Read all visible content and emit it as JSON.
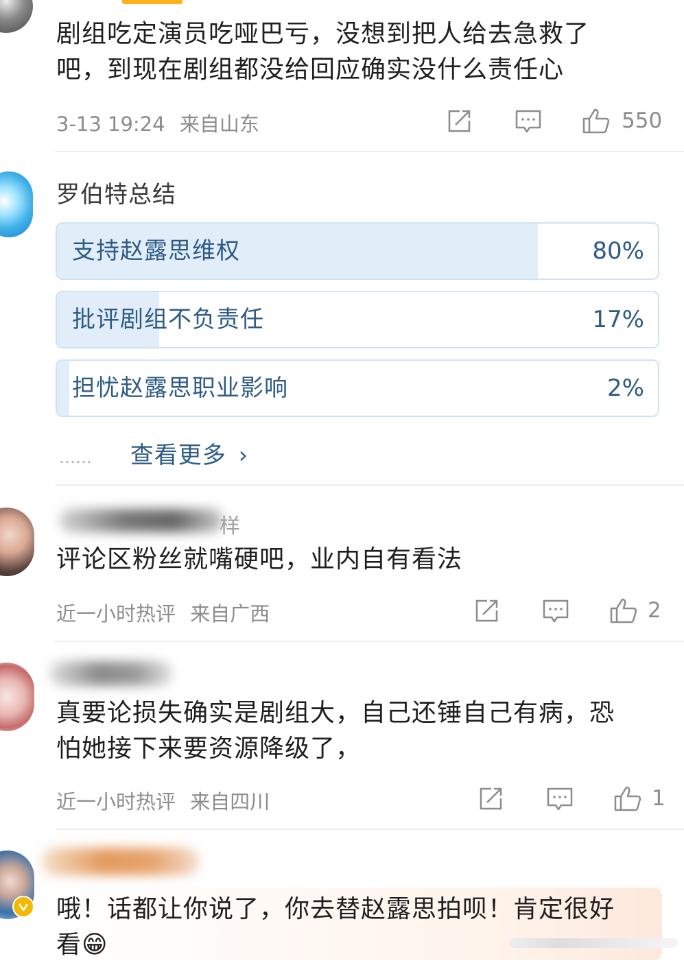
{
  "comments": [
    {
      "text_lines": [
        "剧组吃定演员吃哑巴亏，没想到把人给去急救了",
        "吧，到现在剧组都没给回应确实没什么责任心"
      ],
      "time": "3-13 19:24",
      "location": "来自山东",
      "likes": "550"
    },
    {
      "name_tail": "样",
      "text_lines": [
        "评论区粉丝就嘴硬吧，业内自有看法"
      ],
      "time": "近一小时热评",
      "location": "来自广西",
      "likes": "2"
    },
    {
      "text_lines": [
        "真要论损失确实是剧组大，自己还锤自己有病，恐",
        "怕她接下来要资源降级了，"
      ],
      "time": "近一小时热评",
      "location": "来自四川",
      "likes": "1"
    },
    {
      "text_lines": [
        "哦！话都让你说了，你去替赵露思拍呗！肯定很好",
        "看😁"
      ]
    }
  ],
  "poll": {
    "title": "罗伯特总结",
    "options": [
      {
        "label": "支持赵露思维权",
        "percent_text": "80%",
        "fill": 0.8
      },
      {
        "label": "批评剧组不负责任",
        "percent_text": "17%",
        "fill": 0.17
      },
      {
        "label": "担忧赵露思职业影响",
        "percent_text": "2%",
        "fill": 0.02
      }
    ],
    "dots": "……",
    "more_label": "查看更多",
    "more_chevron": "›"
  },
  "icons": {
    "share": "share-icon",
    "comment": "comment-icon",
    "like": "thumbs-up-icon",
    "verified": "verified-badge-icon"
  },
  "colors": {
    "poll_border": "#cfe2f3",
    "poll_fill": "#e1eefa",
    "poll_text": "#2e5b86",
    "meta_gray": "#8c8c8c",
    "verified_gold": "#f5b800"
  }
}
